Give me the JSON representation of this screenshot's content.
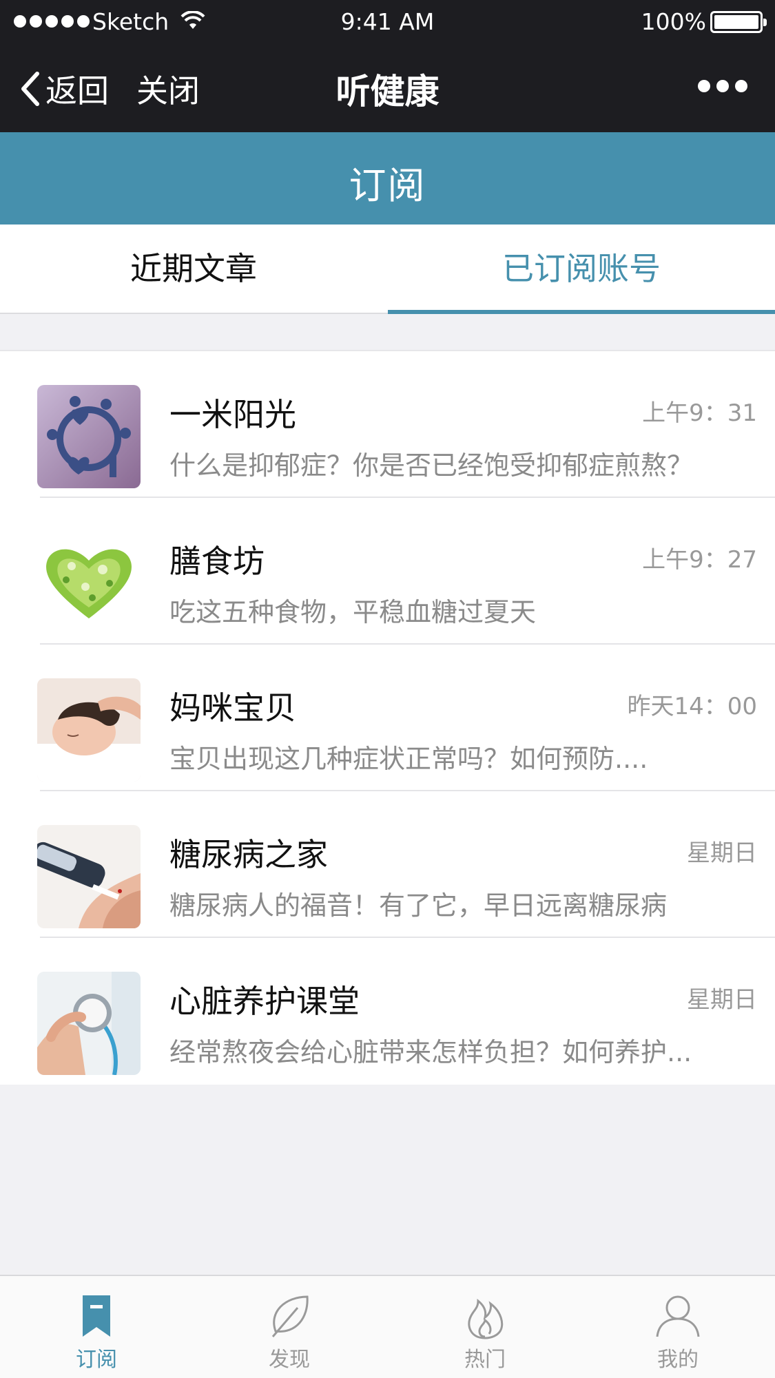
{
  "status_bar": {
    "carrier": "Sketch",
    "time": "9:41 AM",
    "battery": "100%"
  },
  "nav": {
    "back_label": "返回",
    "close_label": "关闭",
    "title": "听健康"
  },
  "section": {
    "title": "订阅"
  },
  "tabs": [
    {
      "label": "近期文章",
      "active": false
    },
    {
      "label": "已订阅账号",
      "active": true
    }
  ],
  "accent_color": "#4690ad",
  "list": [
    {
      "name": "一米阳光",
      "time": "上午9：31",
      "summary": "什么是抑郁症？你是否已经饱受抑郁症煎熬？",
      "icon": "paper-people-heart-image"
    },
    {
      "name": "膳食坊",
      "time": "上午9：27",
      "summary": "吃这五种食物，平稳血糖过夏天",
      "icon": "vegetable-heart-image"
    },
    {
      "name": "妈咪宝贝",
      "time": "昨天14：00",
      "summary": "宝贝出现这几种症状正常吗？如何预防....",
      "icon": "sleeping-baby-image"
    },
    {
      "name": "糖尿病之家",
      "time": "星期日",
      "summary": "糖尿病人的福音！有了它，早日远离糖尿病",
      "icon": "glucose-meter-image"
    },
    {
      "name": "心脏养护课堂",
      "time": "星期日",
      "summary": "经常熬夜会给心脏带来怎样负担？如何养护...",
      "icon": "stethoscope-image"
    }
  ],
  "tabbar": [
    {
      "label": "订阅",
      "icon": "bookmark-icon",
      "active": true
    },
    {
      "label": "发现",
      "icon": "leaf-icon",
      "active": false
    },
    {
      "label": "热门",
      "icon": "flame-icon",
      "active": false
    },
    {
      "label": "我的",
      "icon": "person-icon",
      "active": false
    }
  ]
}
